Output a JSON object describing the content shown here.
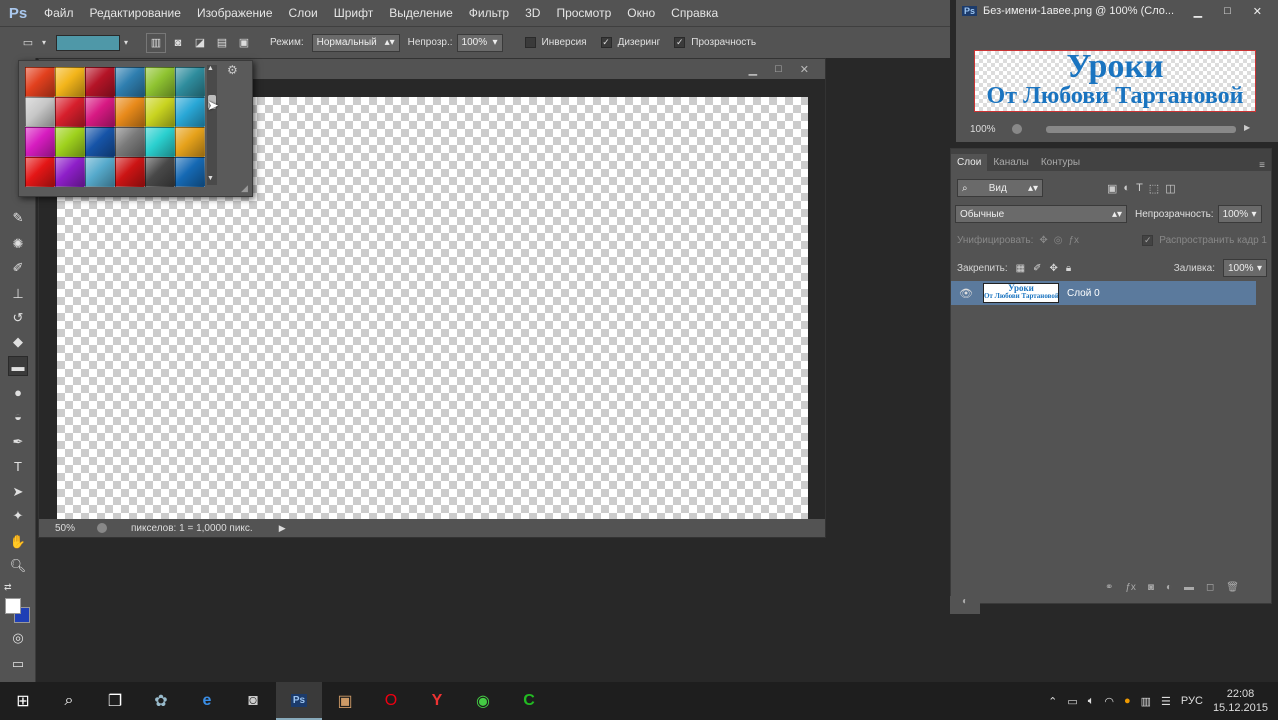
{
  "app": {
    "logo": "Ps"
  },
  "menu": [
    "Файл",
    "Редактирование",
    "Изображение",
    "Слои",
    "Шрифт",
    "Выделение",
    "Фильтр",
    "3D",
    "Просмотр",
    "Окно",
    "Справка"
  ],
  "options": {
    "mode_label": "Режим:",
    "mode_value": "Нормальный",
    "opacity_label": "Непрозр.:",
    "opacity_value": "100%",
    "inversion_label": "Инверсия",
    "dither_label": "Дизеринг",
    "transparency_label": "Прозрачность",
    "gradient_color": "#4f98a8"
  },
  "swatches": [
    "#e2401e",
    "#f3b51a",
    "#b51427",
    "#2f7fb0",
    "#8fc431",
    "#2f8d9e",
    "#c7c7c7",
    "#d71f2c",
    "#d81983",
    "#e88a1a",
    "#c9d420",
    "#29a7d6",
    "#d71cc0",
    "#9fd21d",
    "#1654a8",
    "#7a7a7a",
    "#2ad0cf",
    "#e6a21b",
    "#e41616",
    "#8e1fc9",
    "#56aacc",
    "#cc1414",
    "#484848",
    "#1569b4",
    "#f1d31a",
    "#d41a32",
    "#e7e7e7",
    "#2ec5d8",
    "#f0e020"
  ],
  "document": {
    "zoom": "50%",
    "status_text": "пикселов: 1 = 1,0000 пикс."
  },
  "navigator": {
    "title": "Без-имени-1авее.png @ 100% (Сло...",
    "zoom": "100%",
    "preview_line1": "Уроки",
    "preview_line2": "От Любови Тартановой"
  },
  "layers": {
    "tabs": [
      "Слои",
      "Каналы",
      "Контуры"
    ],
    "filter_label": "Вид",
    "blend_mode": "Обычные",
    "opacity_label": "Непрозрачность:",
    "opacity_value": "100%",
    "unify_label": "Унифицировать:",
    "propagate_label": "Распространить кадр 1",
    "lock_label": "Закрепить:",
    "fill_label": "Заливка:",
    "fill_value": "100%",
    "layer_name": "Слой 0",
    "thumb_text1": "Уроки",
    "thumb_text2": "От Любови Тартановой"
  },
  "taskbar": {
    "lang": "РУС",
    "time": "22:08",
    "date": "15.12.2015"
  },
  "colors": {
    "foreground": "#ffffff",
    "background": "#1f3fb5",
    "selected_layer": "#5b7a9d"
  }
}
